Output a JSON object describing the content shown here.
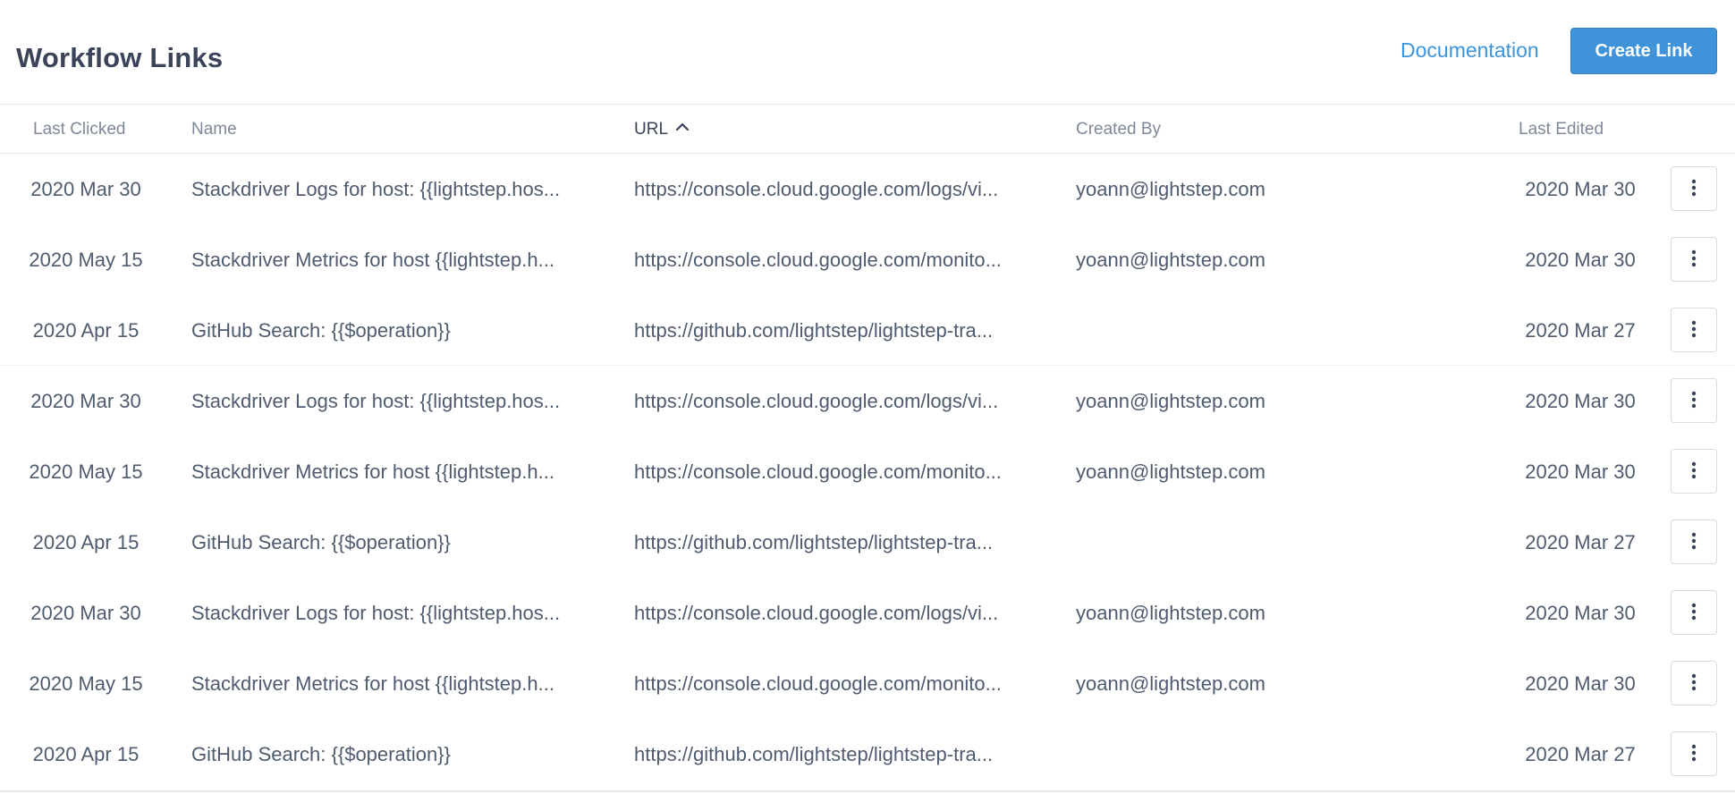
{
  "header": {
    "title": "Workflow Links",
    "documentation_label": "Documentation",
    "create_label": "Create Link"
  },
  "table": {
    "columns": {
      "last_clicked": "Last Clicked",
      "name": "Name",
      "url": "URL",
      "created_by": "Created By",
      "last_edited": "Last Edited"
    },
    "sort": {
      "column": "URL",
      "direction": "ascending",
      "icon": "chevron-up-icon"
    },
    "row_menu_icon": "kebab-menu-icon",
    "rows": [
      {
        "last_clicked": "2020 Mar 30",
        "name": "Stackdriver Logs for host: {{lightstep.hos...",
        "url": "https://console.cloud.google.com/logs/vi...",
        "created_by": "yoann@lightstep.com",
        "last_edited": "2020 Mar 30"
      },
      {
        "last_clicked": "2020 May 15",
        "name": "Stackdriver Metrics for host {{lightstep.h...",
        "url": "https://console.cloud.google.com/monito...",
        "created_by": "yoann@lightstep.com",
        "last_edited": "2020 Mar 30"
      },
      {
        "last_clicked": "2020 Apr 15",
        "name": "GitHub Search: {{$operation}}",
        "url": "https://github.com/lightstep/lightstep-tra...",
        "created_by": "",
        "last_edited": "2020 Mar 27"
      },
      {
        "last_clicked": "2020 Mar 30",
        "name": "Stackdriver Logs for host: {{lightstep.hos...",
        "url": "https://console.cloud.google.com/logs/vi...",
        "created_by": "yoann@lightstep.com",
        "last_edited": "2020 Mar 30"
      },
      {
        "last_clicked": "2020 May 15",
        "name": "Stackdriver Metrics for host {{lightstep.h...",
        "url": "https://console.cloud.google.com/monito...",
        "created_by": "yoann@lightstep.com",
        "last_edited": "2020 Mar 30"
      },
      {
        "last_clicked": "2020 Apr 15",
        "name": "GitHub Search: {{$operation}}",
        "url": "https://github.com/lightstep/lightstep-tra...",
        "created_by": "",
        "last_edited": "2020 Mar 27"
      },
      {
        "last_clicked": "2020 Mar 30",
        "name": "Stackdriver Logs for host: {{lightstep.hos...",
        "url": "https://console.cloud.google.com/logs/vi...",
        "created_by": "yoann@lightstep.com",
        "last_edited": "2020 Mar 30"
      },
      {
        "last_clicked": "2020 May 15",
        "name": "Stackdriver Metrics for host {{lightstep.h...",
        "url": "https://console.cloud.google.com/monito...",
        "created_by": "yoann@lightstep.com",
        "last_edited": "2020 Mar 30"
      },
      {
        "last_clicked": "2020 Apr 15",
        "name": "GitHub Search: {{$operation}}",
        "url": "https://github.com/lightstep/lightstep-tra...",
        "created_by": "",
        "last_edited": "2020 Mar 27"
      }
    ]
  }
}
